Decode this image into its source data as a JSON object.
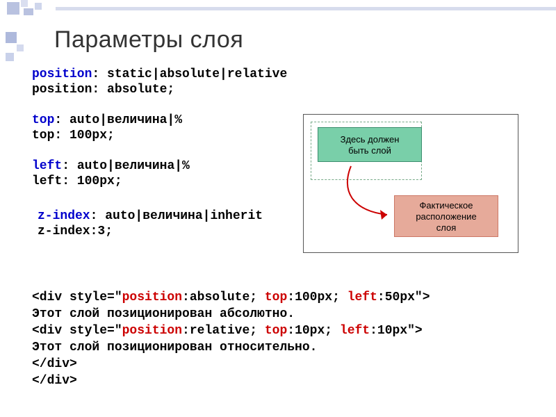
{
  "title": "Параметры слоя",
  "rules": {
    "position_syntax_prop": "position",
    "position_syntax_vals": ": static|absolute|relative",
    "position_example": "position: absolute;",
    "top_syntax_prop": "top",
    "top_syntax_vals": ": auto|величина|%",
    "top_example": "top: 100px;",
    "left_syntax_prop": "left",
    "left_syntax_vals": ": auto|величина|%",
    "left_example": "left: 100px;",
    "zindex_syntax_prop": "z-index",
    "zindex_syntax_vals": ": auto|величина|inherit",
    "zindex_example": "z-index:3;"
  },
  "figure": {
    "box1_l1": "Здесь должен",
    "box1_l2": "быть слой",
    "box2_l1": "Фактическое",
    "box2_l2": "расположение",
    "box2_l3": "слоя"
  },
  "example": {
    "l1_a": "<div style=\"",
    "l1_p1": "position",
    "l1_b": ":absolute; ",
    "l1_p2": "top",
    "l1_c": ":100px; ",
    "l1_p3": "left",
    "l1_d": ":50px\">",
    "l2": "Этот слой позиционирован абсолютно.",
    "l3_a": "<div style=\"",
    "l3_p1": "position",
    "l3_b": ":relative; ",
    "l3_p2": "top",
    "l3_c": ":10px; ",
    "l3_p3": "left",
    "l3_d": ":10px\">",
    "l4": "Этот слой позиционирован относительно.",
    "l5": "</div>",
    "l6": "</div>"
  }
}
